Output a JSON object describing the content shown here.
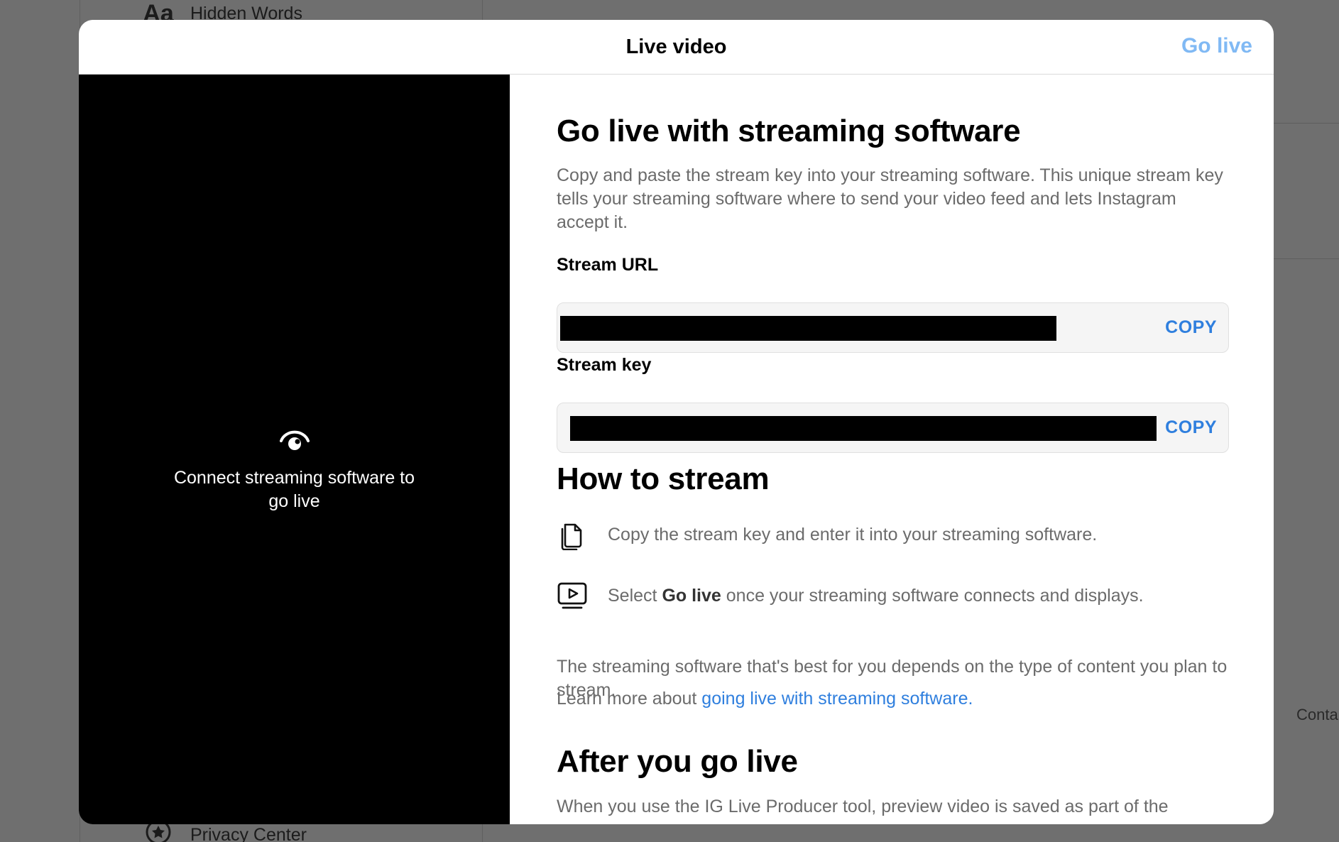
{
  "background": {
    "top_item": {
      "icon": "Aa",
      "label": "Hidden Words"
    },
    "bottom_item": {
      "icon": "privacy-center-icon",
      "label": "Privacy Center"
    },
    "contact": "Conta"
  },
  "modal": {
    "title": "Live video",
    "go_live_label": "Go live",
    "preview": {
      "icon": "live-eye-icon",
      "text": "Connect streaming software to go live"
    },
    "heading": "Go live with streaming software",
    "description": "Copy and paste the stream key into your streaming software. This unique stream key tells your streaming software where to send your video feed and lets Instagram accept it.",
    "stream_url": {
      "label": "Stream URL",
      "value": "",
      "copy_label": "COPY"
    },
    "stream_key": {
      "label": "Stream key",
      "value": "",
      "copy_label": "COPY"
    },
    "how_heading": "How to stream",
    "steps": [
      {
        "icon": "copy-icon",
        "text": "Copy the stream key and enter it into your streaming software."
      },
      {
        "icon": "video-play-icon",
        "prefix": "Select ",
        "bold": "Go live",
        "suffix": " once your streaming software connects and displays."
      }
    ],
    "note": "The streaming software that's best for you depends on the type of content you plan to stream.",
    "learn_prefix": "Learn more about ",
    "learn_link": "going live with streaming software.",
    "after_heading": "After you go live",
    "after_text": "When you use the IG Live Producer tool, preview video is saved as part of the"
  },
  "colors": {
    "accent": "#2f7fde",
    "go_live_disabled": "#80b9f4",
    "preview_bg": "#000000"
  }
}
